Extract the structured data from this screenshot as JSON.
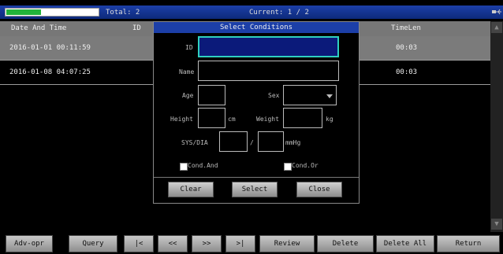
{
  "status": {
    "battery_level": 0.38,
    "total": "Total: 2",
    "current": "Current: 1 / 2"
  },
  "table": {
    "columns": [
      "Date And Time",
      "ID",
      "TimeLen"
    ],
    "rows": [
      {
        "datetime": "2016-01-01 00:11:59",
        "timelen": "00:03"
      },
      {
        "datetime": "2016-01-08 04:07:25",
        "timelen": "00:03"
      }
    ]
  },
  "dialog": {
    "title": "Select Conditions",
    "id_label": "ID",
    "id_value": "",
    "name_label": "Name",
    "name_value": "",
    "age_label": "Age",
    "sex_label": "Sex",
    "height_label": "Height",
    "height_unit": "cm",
    "weight_label": "Weight",
    "weight_unit": "kg",
    "sysdia_label": "SYS/DIA",
    "sysdia_sep": "/",
    "sysdia_unit": "mmHg",
    "cond_and": "Cond.And",
    "cond_or": "Cond.Or",
    "clear": "Clear",
    "select": "Select",
    "close": "Close"
  },
  "toolbar": {
    "adv_opr": "Adv-opr",
    "query": "Query",
    "first": "|<",
    "prev": "<<",
    "next": ">>",
    "last": ">|",
    "review": "Review",
    "delete": "Delete",
    "delete_all": "Delete All",
    "return": "Return"
  },
  "icons": {
    "usb": "usb-icon",
    "scroll_up": "scroll-up-icon",
    "scroll_down": "scroll-down-icon",
    "combo": "chevron-down-icon"
  }
}
